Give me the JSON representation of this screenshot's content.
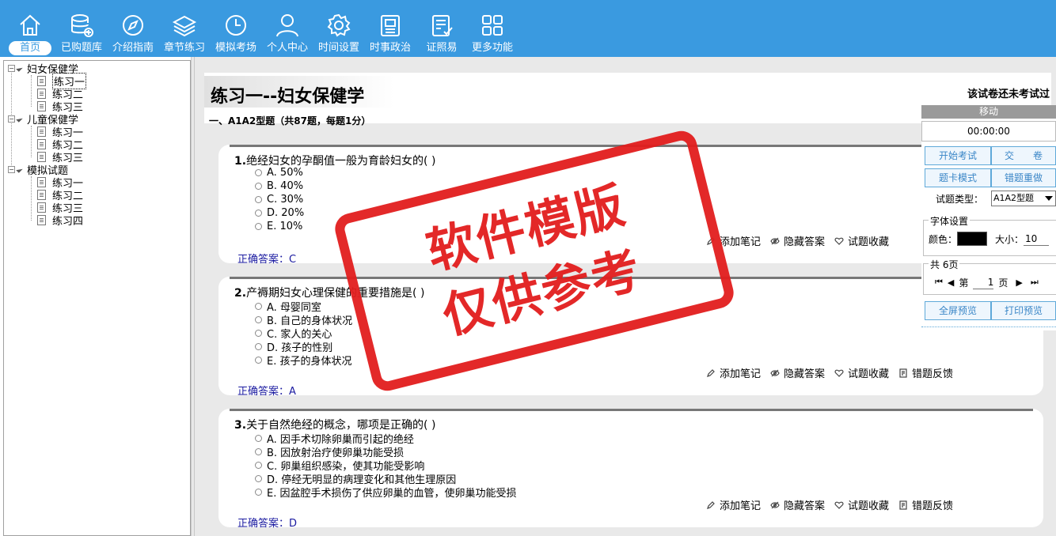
{
  "toolbar": {
    "items": [
      {
        "label": "首页",
        "icon": "home-icon"
      },
      {
        "label": "已购题库",
        "icon": "database-icon"
      },
      {
        "label": "介绍指南",
        "icon": "compass-icon"
      },
      {
        "label": "章节练习",
        "icon": "layers-icon"
      },
      {
        "label": "模拟考场",
        "icon": "clock-icon"
      },
      {
        "label": "个人中心",
        "icon": "user-icon"
      },
      {
        "label": "时间设置",
        "icon": "gear-icon"
      },
      {
        "label": "时事政治",
        "icon": "book-icon"
      },
      {
        "label": "证照易",
        "icon": "checklist-icon"
      },
      {
        "label": "更多功能",
        "icon": "grid-icon"
      }
    ],
    "active_index": 0,
    "colors": {
      "bar": "#3a9ae0",
      "text": "#ffffff"
    }
  },
  "tree": {
    "groups": [
      {
        "label": "妇女保健学",
        "children": [
          "练习一",
          "练习二",
          "练习三"
        ]
      },
      {
        "label": "儿童保健学",
        "children": [
          "练习一",
          "练习二",
          "练习三"
        ]
      },
      {
        "label": "模拟试题",
        "children": [
          "练习一",
          "练习二",
          "练习三",
          "练习四"
        ]
      }
    ],
    "selected": "妇女保健学/练习一"
  },
  "paper": {
    "title": "练习一--妇女保健学",
    "exam_status": "该试卷还未考试过",
    "section_title": "一、A1A2型题（共87题，每题1分）"
  },
  "questions": [
    {
      "number": "1.",
      "text": "绝经妇女的孕酮值一般为育龄妇女的( )",
      "options": [
        "A. 50%",
        "B. 40%",
        "C. 30%",
        "D. 20%",
        "E. 10%"
      ],
      "answer": "正确答案：C"
    },
    {
      "number": "2.",
      "text": "产褥期妇女心理保健的重要措施是( )",
      "options": [
        "A. 母婴同室",
        "B. 自己的身体状况",
        "C. 家人的关心",
        "D. 孩子的性别",
        "E. 孩子的身体状况"
      ],
      "answer": "正确答案：A"
    },
    {
      "number": "3.",
      "text": "关于自然绝经的概念，哪项是正确的( )",
      "options": [
        "A. 因手术切除卵巢而引起的绝经",
        "B. 因放射治疗使卵巢功能受损",
        "C. 卵巢组织感染，使其功能受影响",
        "D. 停经无明显的病理变化和其他生理原因",
        "E. 因盆腔手术损伤了供应卵巢的血管，使卵巢功能受损"
      ],
      "answer": "正确答案：D"
    }
  ],
  "question_actions": {
    "add_note": "添加笔记",
    "hide_answer": "隐藏答案",
    "favorite": "试题收藏",
    "feedback": "错题反馈"
  },
  "panel": {
    "move_label": "移动",
    "timer": "00:00:00",
    "start_exam": "开始考试",
    "submit": "交　　卷",
    "card_mode": "题卡模式",
    "redo_wrong": "错题重做",
    "type_label": "试题类型：",
    "type_value": "A1A2型题",
    "font_legend": "字体设置",
    "color_label": "颜色：",
    "color_value": "#000000",
    "size_label": "大小：",
    "size_value": "10",
    "pages_legend": "共 6页",
    "page_prefix": "第",
    "page_value": "1",
    "page_suffix": "页",
    "fullscreen_preview": "全屏预览",
    "print_preview": "打印预览"
  },
  "watermark": {
    "line1": "软件模版",
    "line2": "仅供参考",
    "color": "#e21d1d"
  }
}
